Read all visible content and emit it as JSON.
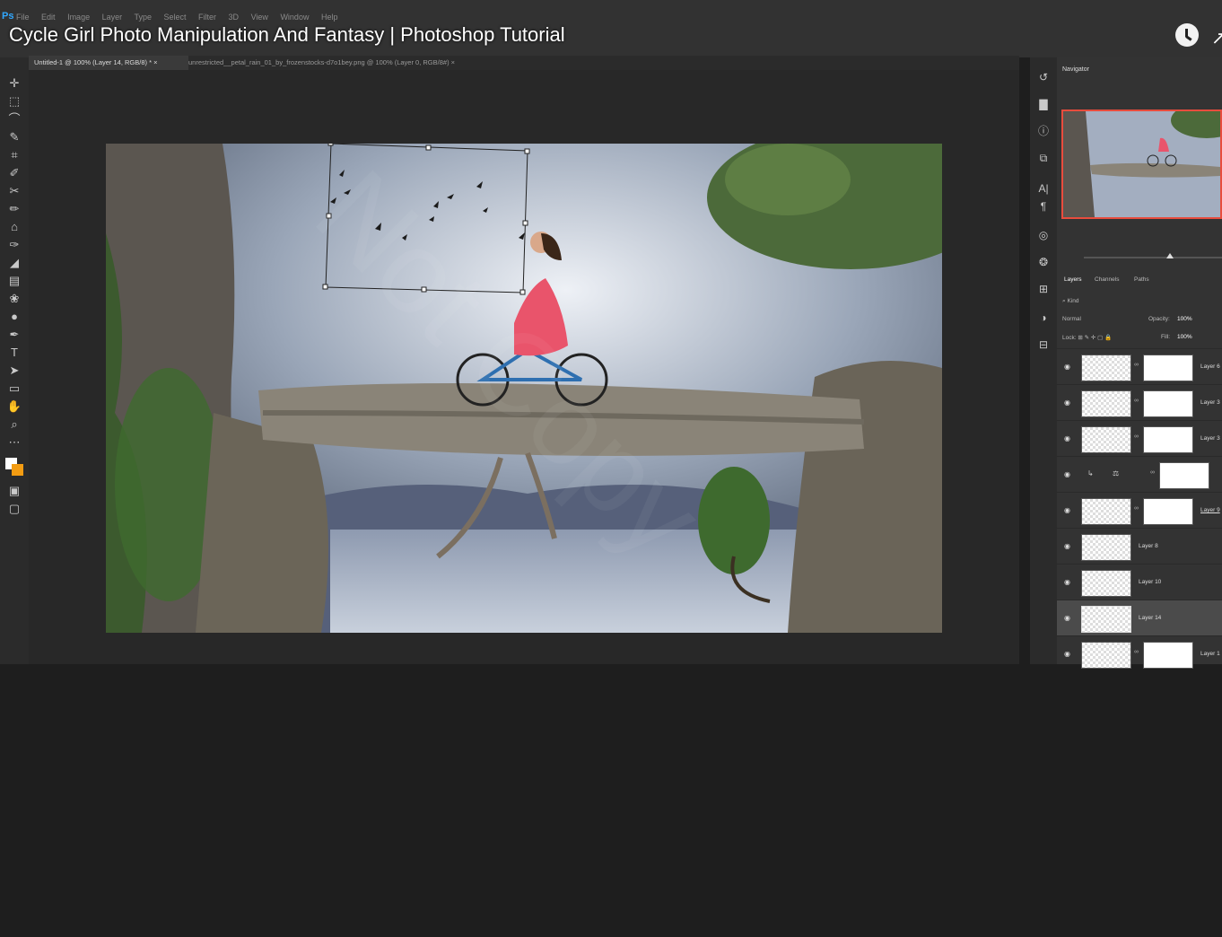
{
  "video_title": "Cycle Girl Photo Manipulation And Fantasy | Photoshop Tutorial",
  "app_logo": "Ps",
  "menu": [
    "File",
    "Edit",
    "Image",
    "Layer",
    "Type",
    "Select",
    "Filter",
    "3D",
    "View",
    "Window",
    "Help"
  ],
  "tabs": [
    {
      "label": "Untitled-1 @ 100% (Layer 14, RGB/8) *",
      "close": "×"
    },
    {
      "label": "unrestricted__petal_rain_01_by_frozenstocks-d7o1bey.png @ 100% (Layer 0, RGB/8#)",
      "close": "×"
    }
  ],
  "watermark": "Not Copy",
  "navigator": {
    "tab": "Navigator"
  },
  "layers_panel": {
    "tabs": [
      "Layers",
      "Channels",
      "Paths"
    ],
    "kind_placeholder": "Kind",
    "blend_mode": "Normal",
    "opacity_label": "Opacity:",
    "opacity": "100%",
    "lock_label": "Lock:",
    "fill_label": "Fill:",
    "fill": "100%",
    "layers": [
      {
        "name": "Layer 6",
        "mask": true
      },
      {
        "name": "Layer 3",
        "mask": true
      },
      {
        "name": "Layer 3",
        "mask": true
      },
      {
        "name": "",
        "mask": true,
        "adjustment": true
      },
      {
        "name": "Layer 9",
        "mask": true
      },
      {
        "name": "Layer 8",
        "mask": false
      },
      {
        "name": "Layer 10",
        "mask": false
      },
      {
        "name": "Layer 14",
        "mask": false,
        "selected": true
      },
      {
        "name": "Layer 1",
        "mask": true
      }
    ]
  },
  "colors": {
    "accent": "#e84c3d",
    "foreground": "#ffffff",
    "background_swatch": "#f39c12",
    "selected_layer": "#4b4b4b"
  }
}
